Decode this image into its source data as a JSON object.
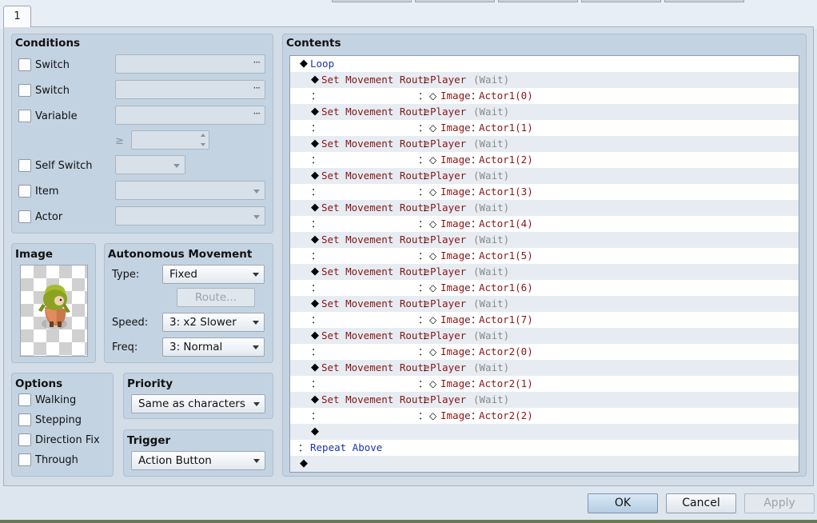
{
  "tabs": [
    {
      "label": "1"
    }
  ],
  "conditions": {
    "title": "Conditions",
    "switch1_label": "Switch",
    "switch2_label": "Switch",
    "variable_label": "Variable",
    "compare_symbol": "≥",
    "self_switch_label": "Self Switch",
    "item_label": "Item",
    "actor_label": "Actor"
  },
  "image": {
    "title": "Image"
  },
  "autonomous_movement": {
    "title": "Autonomous Movement",
    "type_label": "Type:",
    "type_value": "Fixed",
    "route_button": "Route...",
    "speed_label": "Speed:",
    "speed_value": "3: x2 Slower",
    "freq_label": "Freq:",
    "freq_value": "3: Normal"
  },
  "options": {
    "title": "Options",
    "walking": "Walking",
    "stepping": "Stepping",
    "direction_fix": "Direction Fix",
    "through": "Through"
  },
  "priority": {
    "title": "Priority",
    "value": "Same as characters"
  },
  "trigger": {
    "title": "Trigger",
    "value": "Action Button"
  },
  "contents": {
    "title": "Contents",
    "loop_label": "Loop",
    "command_label": "Set Movement Route",
    "colon": "：",
    "target": "Player",
    "wait_note": "(Wait)",
    "image_label": "Image",
    "images": [
      "Actor1(0)",
      "Actor1(1)",
      "Actor1(2)",
      "Actor1(3)",
      "Actor1(4)",
      "Actor1(5)",
      "Actor1(6)",
      "Actor1(7)",
      "Actor2(0)",
      "Actor2(1)",
      "Actor2(2)"
    ],
    "repeat_label": "Repeat Above"
  },
  "buttons": {
    "ok": "OK",
    "cancel": "Cancel",
    "apply": "Apply"
  }
}
